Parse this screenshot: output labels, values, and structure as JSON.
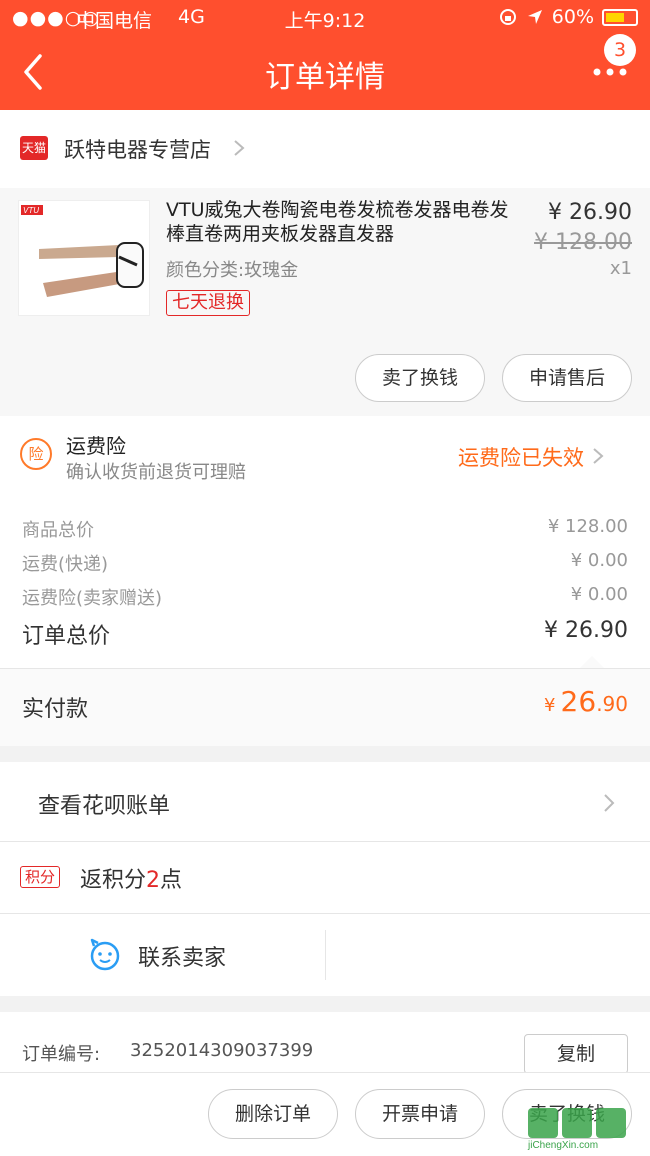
{
  "status_bar": {
    "signal": "●●●○○",
    "carrier": "中国电信",
    "network": "4G",
    "time": "上午9:12",
    "battery": "60%"
  },
  "header": {
    "title": "订单详情",
    "badge": "3"
  },
  "store": {
    "platform_tag": "天猫",
    "name": "跃特电器专营店"
  },
  "product": {
    "brand": "VTU",
    "title": "VTU威兔大卷陶瓷电卷发梳卷发器电卷发棒直卷两用夹板发器直发器",
    "spec": "颜色分类:玫瑰金",
    "tag": "七天退换",
    "price": "¥ 26.90",
    "original_price": "¥ 128.00",
    "quantity": "x1",
    "buttons": [
      "卖了换钱",
      "申请售后"
    ]
  },
  "insurance": {
    "icon_text": "险",
    "title": "运费险",
    "subtitle": "确认收货前退货可理赔",
    "status": "运费险已失效"
  },
  "summary": {
    "rows": [
      {
        "label": "商品总价",
        "value": "¥ 128.00"
      },
      {
        "label": "运费(快递)",
        "value": "¥ 0.00"
      },
      {
        "label": "运费险(卖家赠送)",
        "value": "¥ 0.00"
      }
    ],
    "total_label": "订单总价",
    "total_value": "¥ 26.90"
  },
  "paid": {
    "label": "实付款",
    "currency": "¥",
    "integer": "26",
    "decimal": ".90"
  },
  "huabei": {
    "label": "查看花呗账单"
  },
  "points": {
    "tag": "积分",
    "prefix": "返积分",
    "count": "2",
    "suffix": "点"
  },
  "contact": {
    "label": "联系卖家"
  },
  "order": {
    "label": "订单编号:",
    "number": "3252014309037399",
    "copy": "复制"
  },
  "bottom_bar": {
    "buttons": [
      "删除订单",
      "开票申请",
      "卖了换钱"
    ]
  },
  "watermark": {
    "line1": "jiChengXin.com"
  },
  "colors": {
    "header": "#ff4f2e",
    "accent_orange": "#ff6a1a",
    "tmall_red": "#e32828"
  }
}
